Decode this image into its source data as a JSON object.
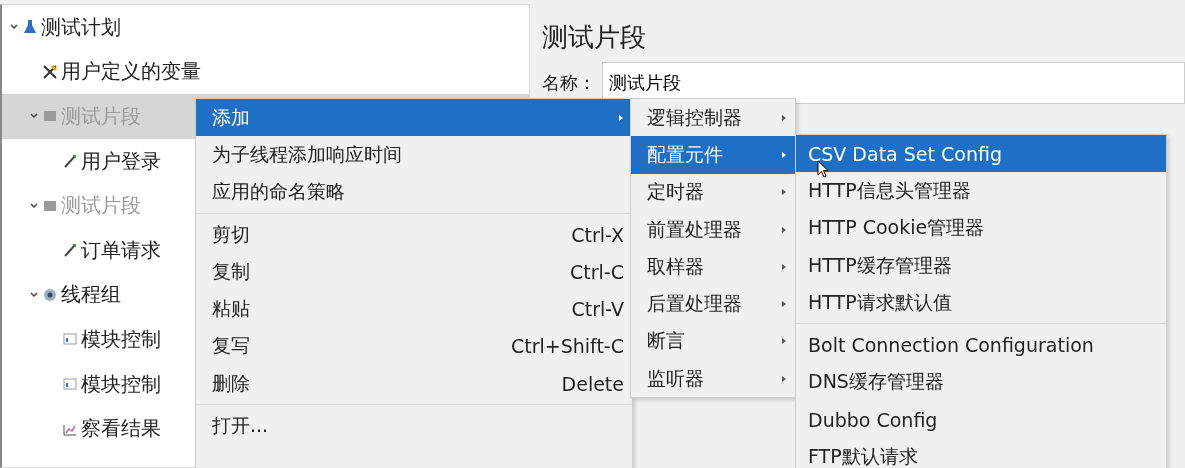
{
  "tree": [
    {
      "label": "测试计划",
      "kind": "plan",
      "expanded": true,
      "selected": false,
      "disabled": false,
      "children": [
        {
          "label": "用户定义的变量",
          "kind": "variables",
          "selected": false,
          "disabled": false
        },
        {
          "label": "测试片段",
          "kind": "fragment",
          "expanded": true,
          "selected": true,
          "disabled": true,
          "children": [
            {
              "label": "用户登录",
              "kind": "sampler",
              "selected": false,
              "disabled": false
            }
          ]
        },
        {
          "label": "测试片段",
          "kind": "fragment",
          "expanded": true,
          "selected": false,
          "disabled": true,
          "children": [
            {
              "label": "订单请求",
              "kind": "sampler",
              "selected": false,
              "disabled": false
            }
          ]
        },
        {
          "label": "线程组",
          "kind": "thread_group",
          "expanded": true,
          "selected": false,
          "disabled": false,
          "children": [
            {
              "label": "模块控制",
              "kind": "controller",
              "selected": false,
              "disabled": false
            },
            {
              "label": "模块控制",
              "kind": "controller",
              "selected": false,
              "disabled": false
            },
            {
              "label": "察看结果",
              "kind": "listener",
              "selected": false,
              "disabled": false
            }
          ]
        }
      ]
    }
  ],
  "panel": {
    "title": "测试片段",
    "name_label": "名称：",
    "name_value": "测试片段"
  },
  "context_menu": [
    {
      "kind": "submenu",
      "label": "添加",
      "selected": true
    },
    {
      "kind": "item",
      "label": "为子线程添加响应时间",
      "selected": false
    },
    {
      "kind": "item",
      "label": "应用的命名策略",
      "selected": false
    },
    {
      "kind": "separator"
    },
    {
      "kind": "item",
      "label": "剪切",
      "shortcut": "Ctrl-X",
      "selected": false
    },
    {
      "kind": "item",
      "label": "复制",
      "shortcut": "Ctrl-C",
      "selected": false
    },
    {
      "kind": "item",
      "label": "粘贴",
      "shortcut": "Ctrl-V",
      "selected": false
    },
    {
      "kind": "item",
      "label": "复写",
      "shortcut": "Ctrl+Shift-C",
      "selected": false
    },
    {
      "kind": "item",
      "label": "删除",
      "shortcut": "Delete",
      "selected": false
    },
    {
      "kind": "separator"
    },
    {
      "kind": "item",
      "label": "打开...",
      "selected": false
    }
  ],
  "add_menu": [
    {
      "kind": "submenu",
      "label": "逻辑控制器",
      "selected": false
    },
    {
      "kind": "submenu",
      "label": "配置元件",
      "selected": true
    },
    {
      "kind": "submenu",
      "label": "定时器",
      "selected": false
    },
    {
      "kind": "submenu",
      "label": "前置处理器",
      "selected": false
    },
    {
      "kind": "submenu",
      "label": "取样器",
      "selected": false
    },
    {
      "kind": "submenu",
      "label": "后置处理器",
      "selected": false
    },
    {
      "kind": "submenu",
      "label": "断言",
      "selected": false
    },
    {
      "kind": "submenu",
      "label": "监听器",
      "selected": false
    }
  ],
  "config_menu": [
    {
      "kind": "item",
      "label": "CSV Data Set Config",
      "selected": true
    },
    {
      "kind": "item",
      "label": "HTTP信息头管理器",
      "selected": false
    },
    {
      "kind": "item",
      "label": "HTTP Cookie管理器",
      "selected": false
    },
    {
      "kind": "item",
      "label": "HTTP缓存管理器",
      "selected": false
    },
    {
      "kind": "item",
      "label": "HTTP请求默认值",
      "selected": false
    },
    {
      "kind": "separator"
    },
    {
      "kind": "item",
      "label": "Bolt Connection Configuration",
      "selected": false
    },
    {
      "kind": "item",
      "label": "DNS缓存管理器",
      "selected": false
    },
    {
      "kind": "item",
      "label": "Dubbo Config",
      "selected": false
    },
    {
      "kind": "item",
      "label": "FTP默认请求",
      "selected": false
    }
  ]
}
